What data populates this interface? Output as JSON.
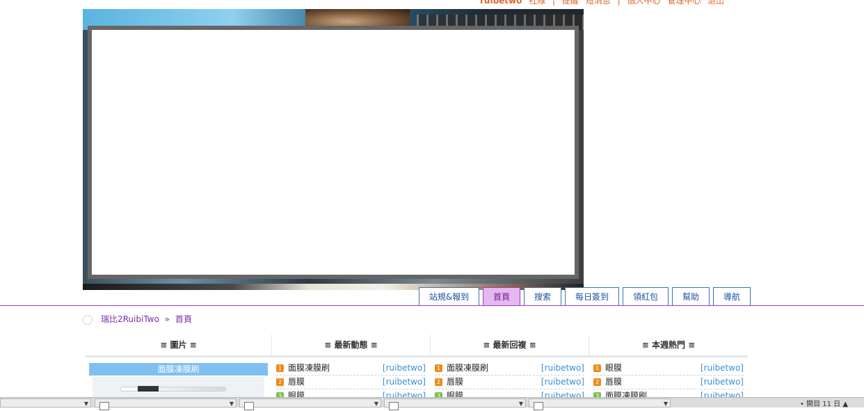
{
  "toplinks": {
    "user": "ruibetwo",
    "items": [
      "社綠",
      "|",
      "提醒",
      "短消息",
      "|",
      "個人中心",
      "管理中心",
      "退出"
    ]
  },
  "nav": {
    "items": [
      {
        "label": "站規&報到"
      },
      {
        "label": "首頁",
        "active": true
      },
      {
        "label": "搜索"
      },
      {
        "label": "每日簽到"
      },
      {
        "label": "領紅包"
      },
      {
        "label": "幫助"
      },
      {
        "label": "導航"
      }
    ]
  },
  "breadcrumb": {
    "site": "瑞比2RuibiTwo",
    "separator": "»",
    "current": "首頁"
  },
  "portal": {
    "pictures": {
      "title": "≡ 圖片 ≡",
      "caption": "面膜凍膜刷"
    },
    "latest_activity": {
      "title": "≡ 最新動態 ≡",
      "rows": [
        {
          "num": "1",
          "title": "面膜凍膜刷",
          "author": "[ruibetwo]",
          "color": "#f08a1e"
        },
        {
          "num": "2",
          "title": "唇膜",
          "author": "[ruibetwo]",
          "color": "#f08a1e"
        },
        {
          "num": "3",
          "title": "眼膜",
          "author": "[ruibetwo]",
          "color": "#7cc04a"
        }
      ]
    },
    "latest_replies": {
      "title": "≡ 最新回複 ≡",
      "rows": [
        {
          "num": "1",
          "title": "面膜凍膜刷",
          "author": "[ruibetwo]",
          "color": "#f08a1e"
        },
        {
          "num": "2",
          "title": "唇膜",
          "author": "[ruibetwo]",
          "color": "#f08a1e"
        },
        {
          "num": "3",
          "title": "眼膜",
          "author": "[ruibetwo]",
          "color": "#7cc04a"
        }
      ]
    },
    "weekly_hot": {
      "title": "≡ 本週熱門 ≡",
      "rows": [
        {
          "num": "1",
          "title": "眼膜",
          "author": "[ruibetwo]",
          "color": "#f08a1e"
        },
        {
          "num": "2",
          "title": "唇膜",
          "author": "[ruibetwo]",
          "color": "#f08a1e"
        },
        {
          "num": "3",
          "title": "面膜凍膜刷",
          "author": "[ruibetwo]",
          "color": "#7cc04a"
        }
      ]
    }
  },
  "taskbar": {
    "tray_text": "• 開目 11 日 ▲"
  },
  "colors": {
    "accent": "#9b3ec6",
    "link": "#1f4fa0",
    "author": "#3a8ed6",
    "toplink": "#e0632a"
  }
}
